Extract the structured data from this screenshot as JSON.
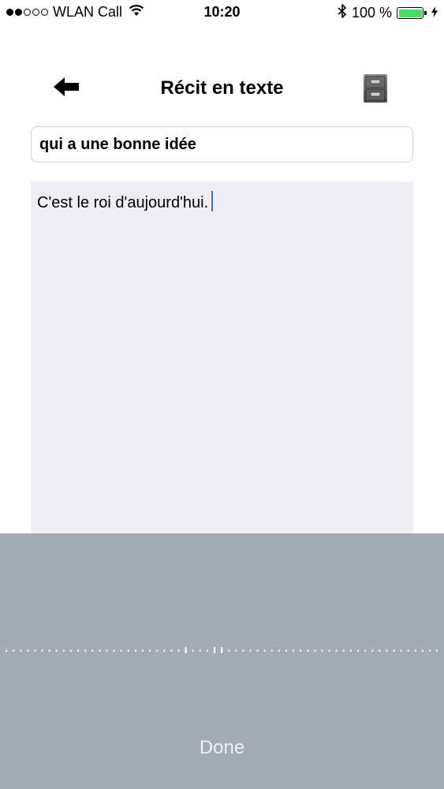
{
  "status_bar": {
    "carrier": "WLAN Call",
    "time": "10:20",
    "battery_text": "100 %",
    "signal": {
      "filled": 2,
      "total": 5
    },
    "battery_level": 1.0,
    "battery_color": "#4cd964",
    "icons": [
      "wifi-icon",
      "bluetooth-icon",
      "battery-icon",
      "charging-bolt-icon"
    ]
  },
  "nav": {
    "title": "Récit en texte",
    "back_icon": "arrow-left-icon",
    "action_icon": "file-cabinet-icon"
  },
  "form": {
    "title_value": "qui a une bonne idée",
    "body_text": "C'est le roi d'aujourd'hui."
  },
  "dictation": {
    "done_label": "Done",
    "background": "#a3abb5",
    "caret_color": "#3a6fe0"
  }
}
